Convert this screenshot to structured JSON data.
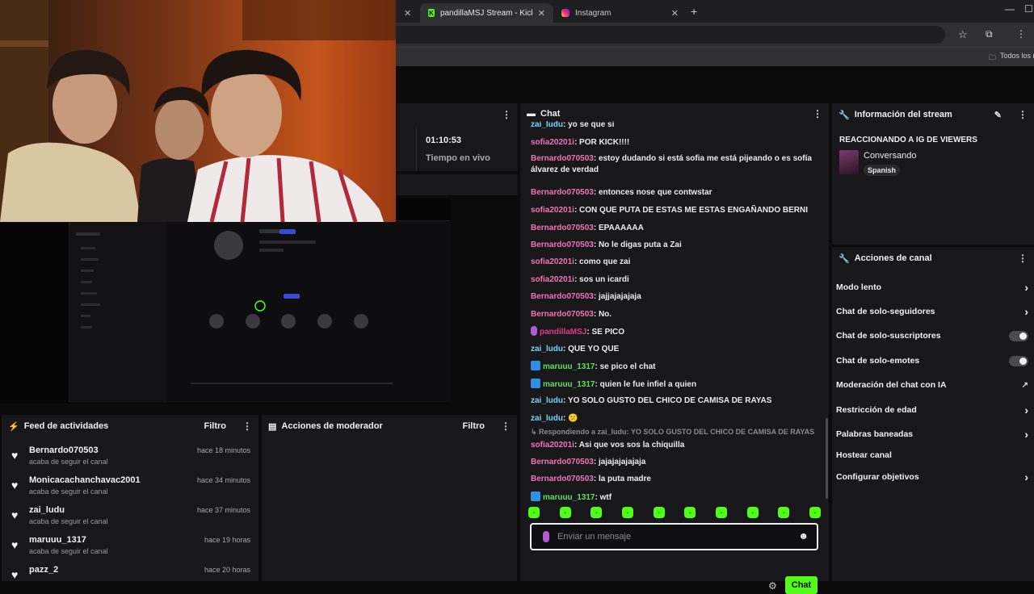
{
  "browser": {
    "tabs": [
      {
        "label": "pandillaMSJ Stream - Kick Dash",
        "icon": "kick-icon",
        "active": true
      },
      {
        "label": "Instagram",
        "icon": "instagram-icon",
        "active": false
      }
    ],
    "bookmarks_all": "Todos los ma"
  },
  "stream_stats": {
    "live_time": "01:10:53",
    "live_label": "Tiempo en vivo"
  },
  "feed": {
    "title": "Feed de actividades",
    "filter_label": "Filtro",
    "items": [
      {
        "name": "Bernardo070503",
        "sub": "acaba de seguir el canal",
        "time": "hace 18 minutos"
      },
      {
        "name": "Monicacachanchavac2001",
        "sub": "acaba de seguir el canal",
        "time": "hace 34 minutos"
      },
      {
        "name": "zai_ludu",
        "sub": "acaba de seguir el canal",
        "time": "hace 37 minutos"
      },
      {
        "name": "maruuu_1317",
        "sub": "acaba de seguir el canal",
        "time": "hace 19 horas"
      },
      {
        "name": "pazz_2",
        "sub": "",
        "time": "hace 20 horas"
      }
    ]
  },
  "moderator": {
    "title": "Acciones de moderador",
    "filter_label": "Filtro"
  },
  "chat": {
    "title": "Chat",
    "messages": [
      {
        "user": "zai_ludu",
        "color": "blue",
        "text": "yo se que si",
        "badge": ""
      },
      {
        "user": "sofia20201i",
        "color": "pink",
        "text": "POR KICK!!!!",
        "badge": ""
      },
      {
        "user": "Bernardo070503",
        "color": "pink",
        "text": "estoy dudando si está sofia me está pijeando o es sofía álvarez de verdad",
        "badge": ""
      },
      {
        "user": "Bernardo070503",
        "color": "pink",
        "text": "entonces nose que contwstar",
        "badge": ""
      },
      {
        "user": "sofia20201i",
        "color": "pink",
        "text": "CON QUE PUTA DE ESTAS ME ESTAS ENGAÑANDO BERNI",
        "badge": ""
      },
      {
        "user": "Bernardo070503",
        "color": "pink",
        "text": "EPAAAAAA",
        "badge": ""
      },
      {
        "user": "Bernardo070503",
        "color": "pink",
        "text": "No le digas puta a Zai",
        "badge": ""
      },
      {
        "user": "sofia20201i",
        "color": "pink",
        "text": "como que zai",
        "badge": ""
      },
      {
        "user": "sofia20201i",
        "color": "pink",
        "text": "sos un icardi",
        "badge": ""
      },
      {
        "user": "Bernardo070503",
        "color": "pink",
        "text": "jajjajajajaja",
        "badge": ""
      },
      {
        "user": "Bernardo070503",
        "color": "pink",
        "text": "No.",
        "badge": ""
      },
      {
        "user": "pandillaMSJ",
        "color": "magenta",
        "text": "SE PICO",
        "badge": "mic"
      },
      {
        "user": "zai_ludu",
        "color": "blue",
        "text": "QUE YO QUE",
        "badge": ""
      },
      {
        "user": "maruuu_1317",
        "color": "green",
        "text": "se pico el chat",
        "badge": "blue"
      },
      {
        "user": "maruuu_1317",
        "color": "green",
        "text": "quien le fue infiel a quien",
        "badge": "blue"
      },
      {
        "user": "zai_ludu",
        "color": "blue",
        "text": "YO SOLO GUSTO DEL CHICO DE CAMISA DE RAYAS",
        "badge": ""
      },
      {
        "user": "zai_ludu",
        "color": "blue",
        "text": "😕",
        "badge": ""
      },
      {
        "user": "sofia20201i",
        "color": "pink",
        "text": "Asi que vos sos la chiquilla",
        "badge": ""
      },
      {
        "user": "Bernardo070503",
        "color": "pink",
        "text": "jajajajajajaja",
        "badge": ""
      },
      {
        "user": "Bernardo070503",
        "color": "pink",
        "text": "la puta madre",
        "badge": ""
      },
      {
        "user": "maruuu_1317",
        "color": "green",
        "text": "wtf",
        "badge": "blue"
      }
    ],
    "reply_line": "Respondiendo a zai_ludu: YO SOLO GUSTO DEL CHICO DE CAMISA DE RAYAS",
    "input_placeholder": "Enviar un mensaje",
    "send_label": "Chat"
  },
  "stream_info": {
    "title": "Información del stream",
    "stream_title": "REACCIONANDO A IG DE VIEWERS",
    "category": "Conversando",
    "language": "Spanish"
  },
  "channel_actions": {
    "title": "Acciones de canal",
    "items": [
      {
        "label": "Modo lento",
        "control": "chevron"
      },
      {
        "label": "Chat de solo-seguidores",
        "control": "chevron"
      },
      {
        "label": "Chat de solo-suscriptores",
        "control": "toggle"
      },
      {
        "label": "Chat de solo-emotes",
        "control": "toggle"
      },
      {
        "label": "Moderación del chat con IA",
        "control": "external"
      },
      {
        "label": "Restricción de edad",
        "control": "chevron"
      },
      {
        "label": "Palabras baneadas",
        "control": "chevron"
      },
      {
        "label": "Hostear canal",
        "control": "none"
      },
      {
        "label": "Configurar objetivos",
        "control": "chevron"
      }
    ]
  },
  "colors": {
    "accent": "#53fc18",
    "panel": "#18181b",
    "user_pink": "#f472b6",
    "user_blue": "#7dd3fc",
    "user_green": "#5ee05e"
  }
}
